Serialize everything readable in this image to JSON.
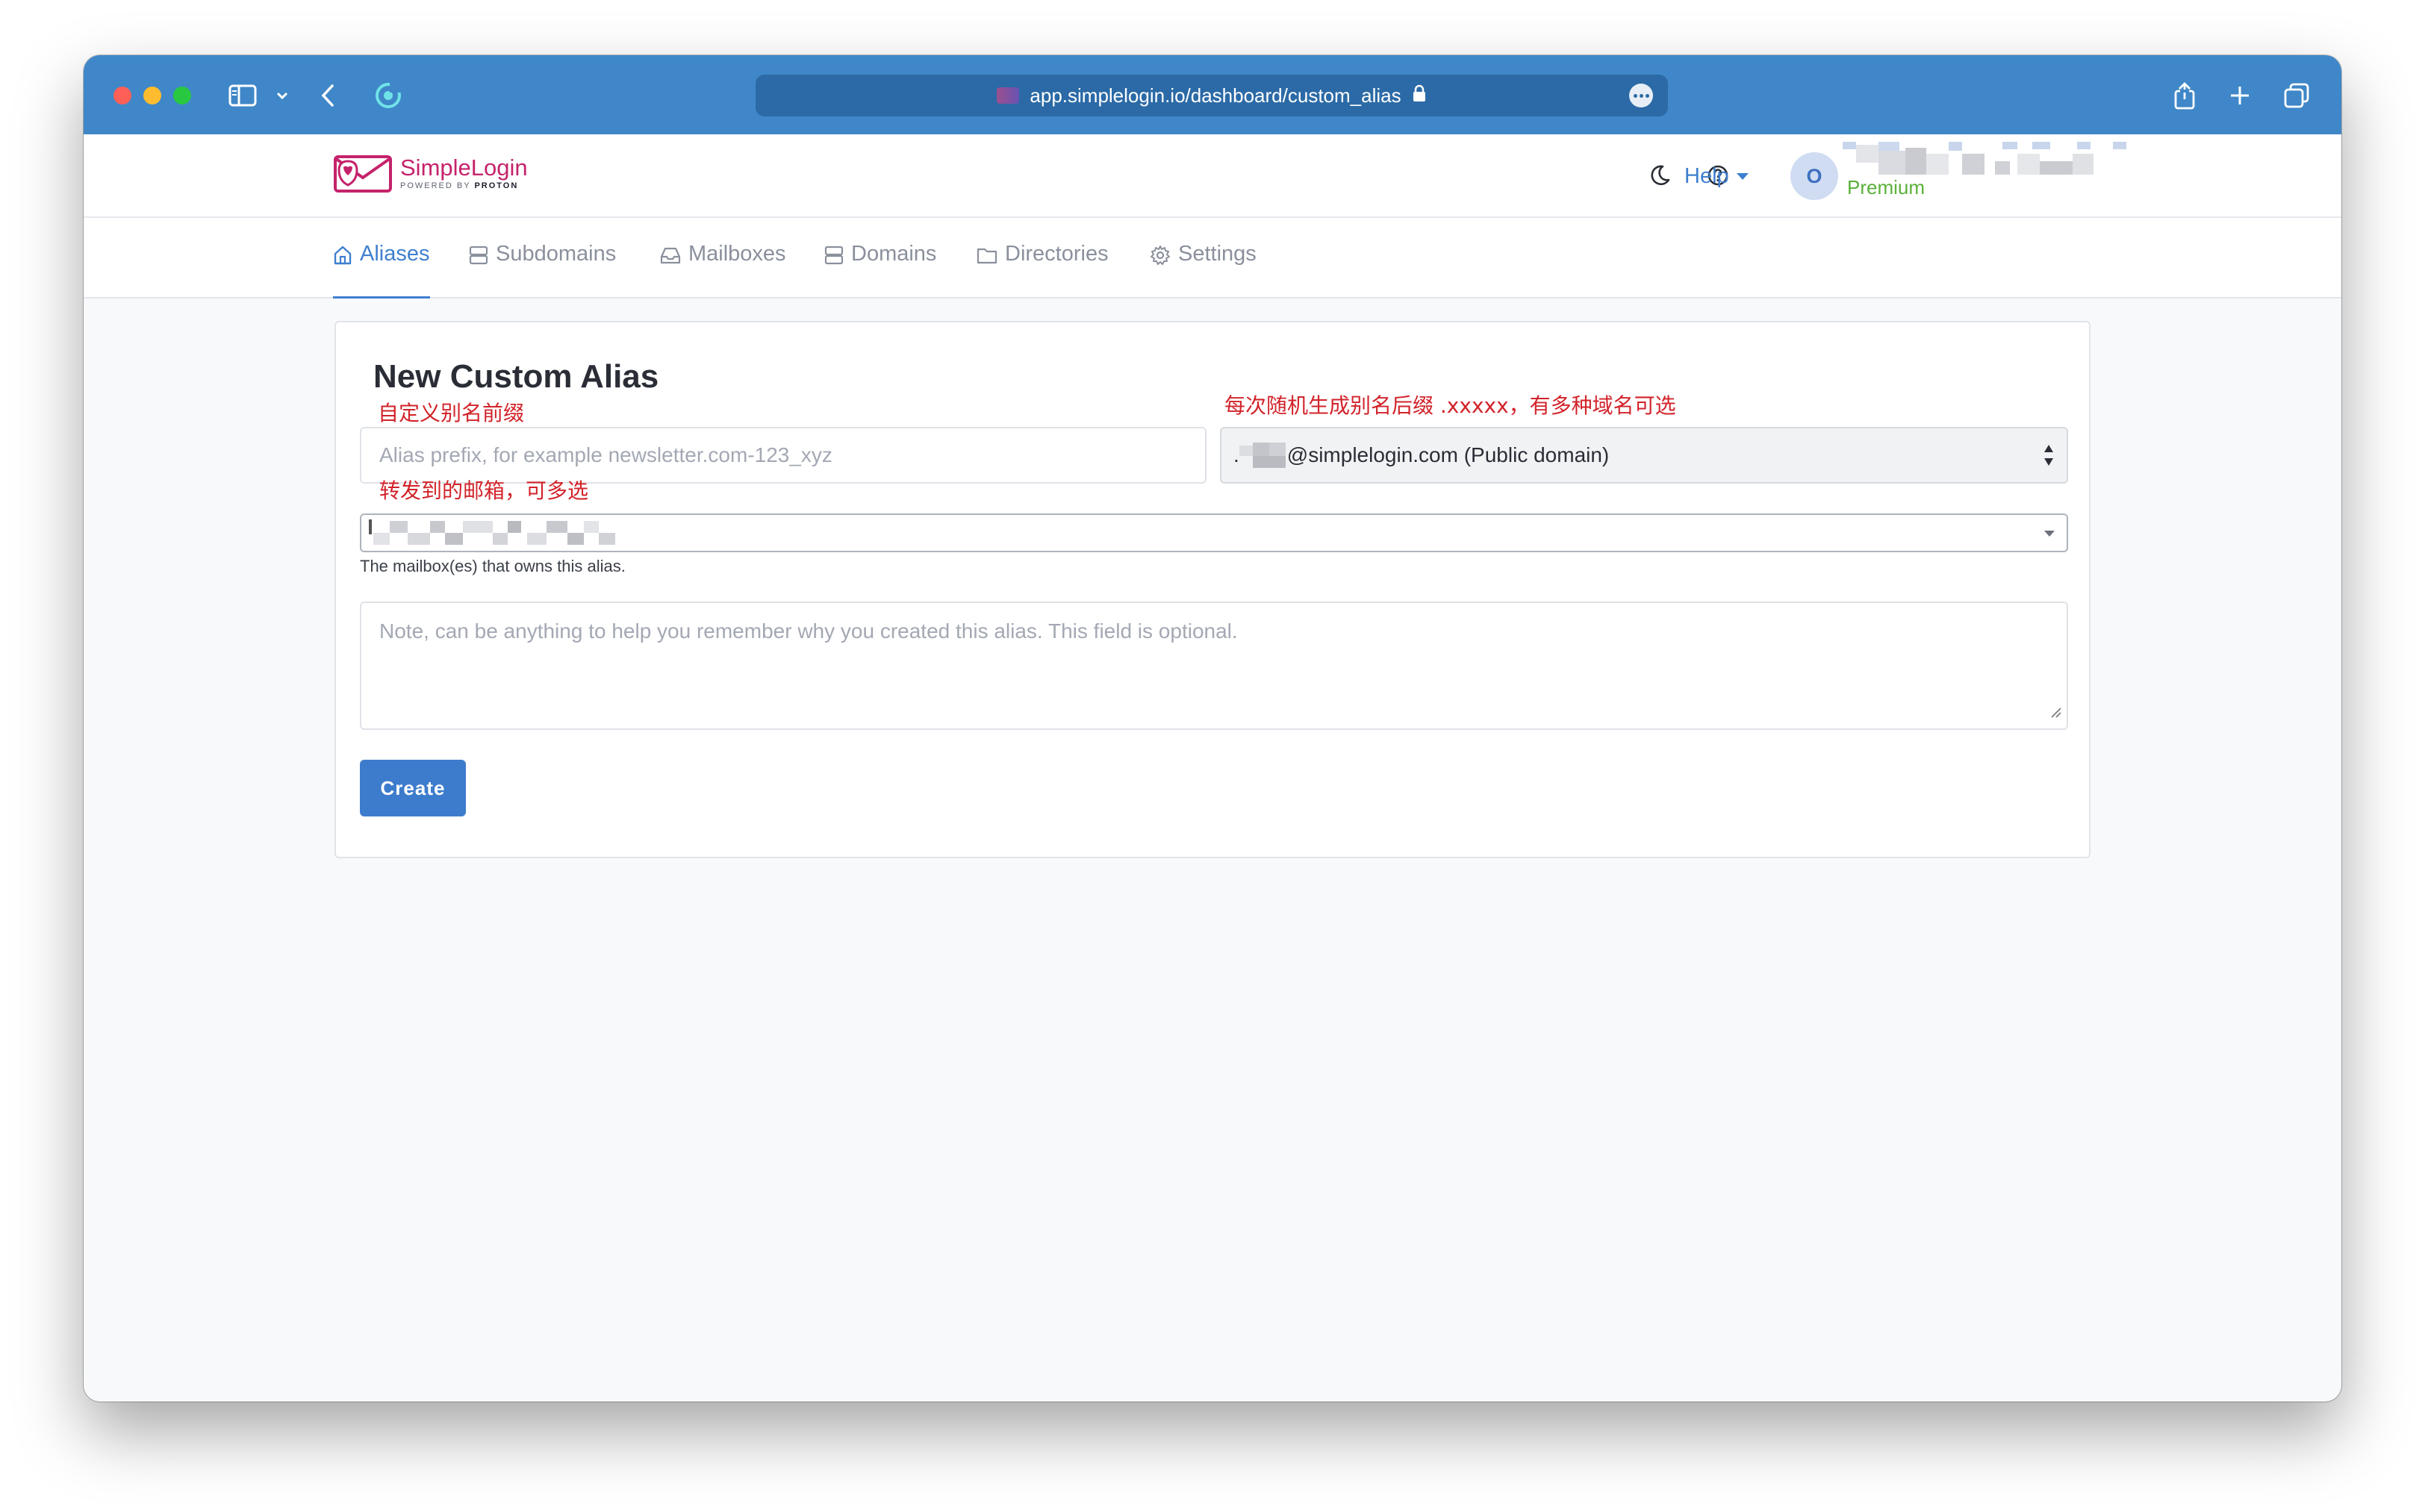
{
  "browser": {
    "url": "app.simplelogin.io/dashboard/custom_alias"
  },
  "header": {
    "logo_name": "SimpleLogin",
    "logo_sub_prefix": "POWERED BY",
    "logo_sub_brand": "PROTON",
    "help_label": "Help",
    "avatar_initial": "O",
    "plan_label": "Premium"
  },
  "nav": {
    "items": [
      {
        "label": "Aliases",
        "icon": "home-icon",
        "active": true
      },
      {
        "label": "Subdomains",
        "icon": "server-icon"
      },
      {
        "label": "Mailboxes",
        "icon": "inbox-icon"
      },
      {
        "label": "Domains",
        "icon": "server-icon"
      },
      {
        "label": "Directories",
        "icon": "folder-icon"
      },
      {
        "label": "Settings",
        "icon": "gear-icon"
      }
    ]
  },
  "form": {
    "title": "New Custom Alias",
    "prefix_placeholder": "Alias prefix, for example newsletter.com-123_xyz",
    "suffix_prefix_char": ".",
    "suffix_value": "@simplelogin.com (Public domain)",
    "mailbox_help": "The mailbox(es) that owns this alias.",
    "note_placeholder": "Note, can be anything to help you remember why you created this alias. This field is optional.",
    "create_label": "Create"
  },
  "annotations": {
    "prefix_note": "自定义别名前缀",
    "suffix_note": "每次随机生成别名后缀 .xxxxx，有多种域名可选",
    "mailbox_note": "转发到的邮箱，可多选"
  },
  "colors": {
    "titlebar": "#3f87c8",
    "accent": "#3f7fcf",
    "brand": "#c5236b",
    "premium": "#5bb03a",
    "annotation": "#d2232a",
    "button": "#3d7ccc"
  }
}
